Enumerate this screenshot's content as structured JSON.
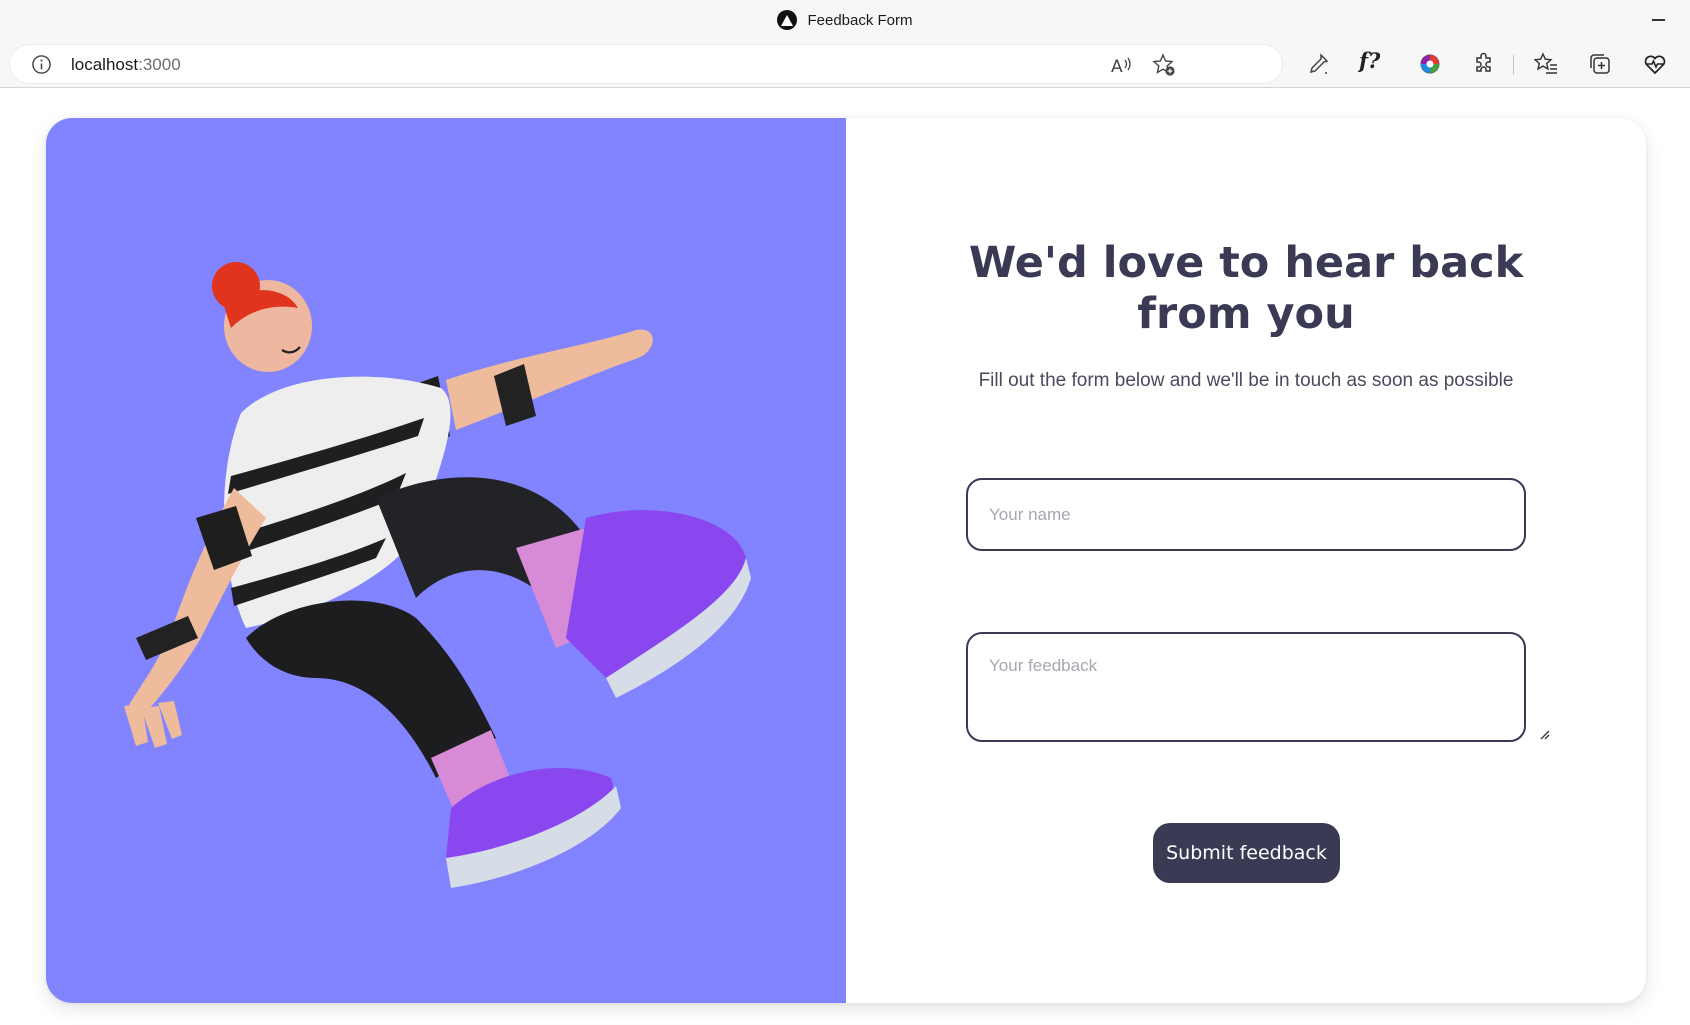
{
  "window": {
    "title": "Feedback Form",
    "favicon": "triangle-logo-icon",
    "minimize_icon": "minimize-icon"
  },
  "address_bar": {
    "host": "localhost",
    "port": ":3000",
    "site_info_icon": "info-icon"
  },
  "toolbar": {
    "icons": [
      "read-aloud-icon",
      "add-favorite-icon",
      "eyedropper-icon",
      "fx-icon",
      "color-wheel-icon",
      "extensions-icon",
      "favorites-icon",
      "collections-icon",
      "browser-essentials-icon"
    ],
    "fx_label": "f?"
  },
  "form": {
    "heading": "We'd love to hear back from you",
    "subtitle": "Fill out the form below and we'll be in touch as soon as possible",
    "name_placeholder": "Your name",
    "name_value": "",
    "feedback_placeholder": "Your feedback",
    "feedback_value": "",
    "submit_label": "Submit feedback"
  },
  "colors": {
    "illustration_bg": "#8184fe",
    "primary": "#3b3a55",
    "button_text": "#ffffff"
  }
}
